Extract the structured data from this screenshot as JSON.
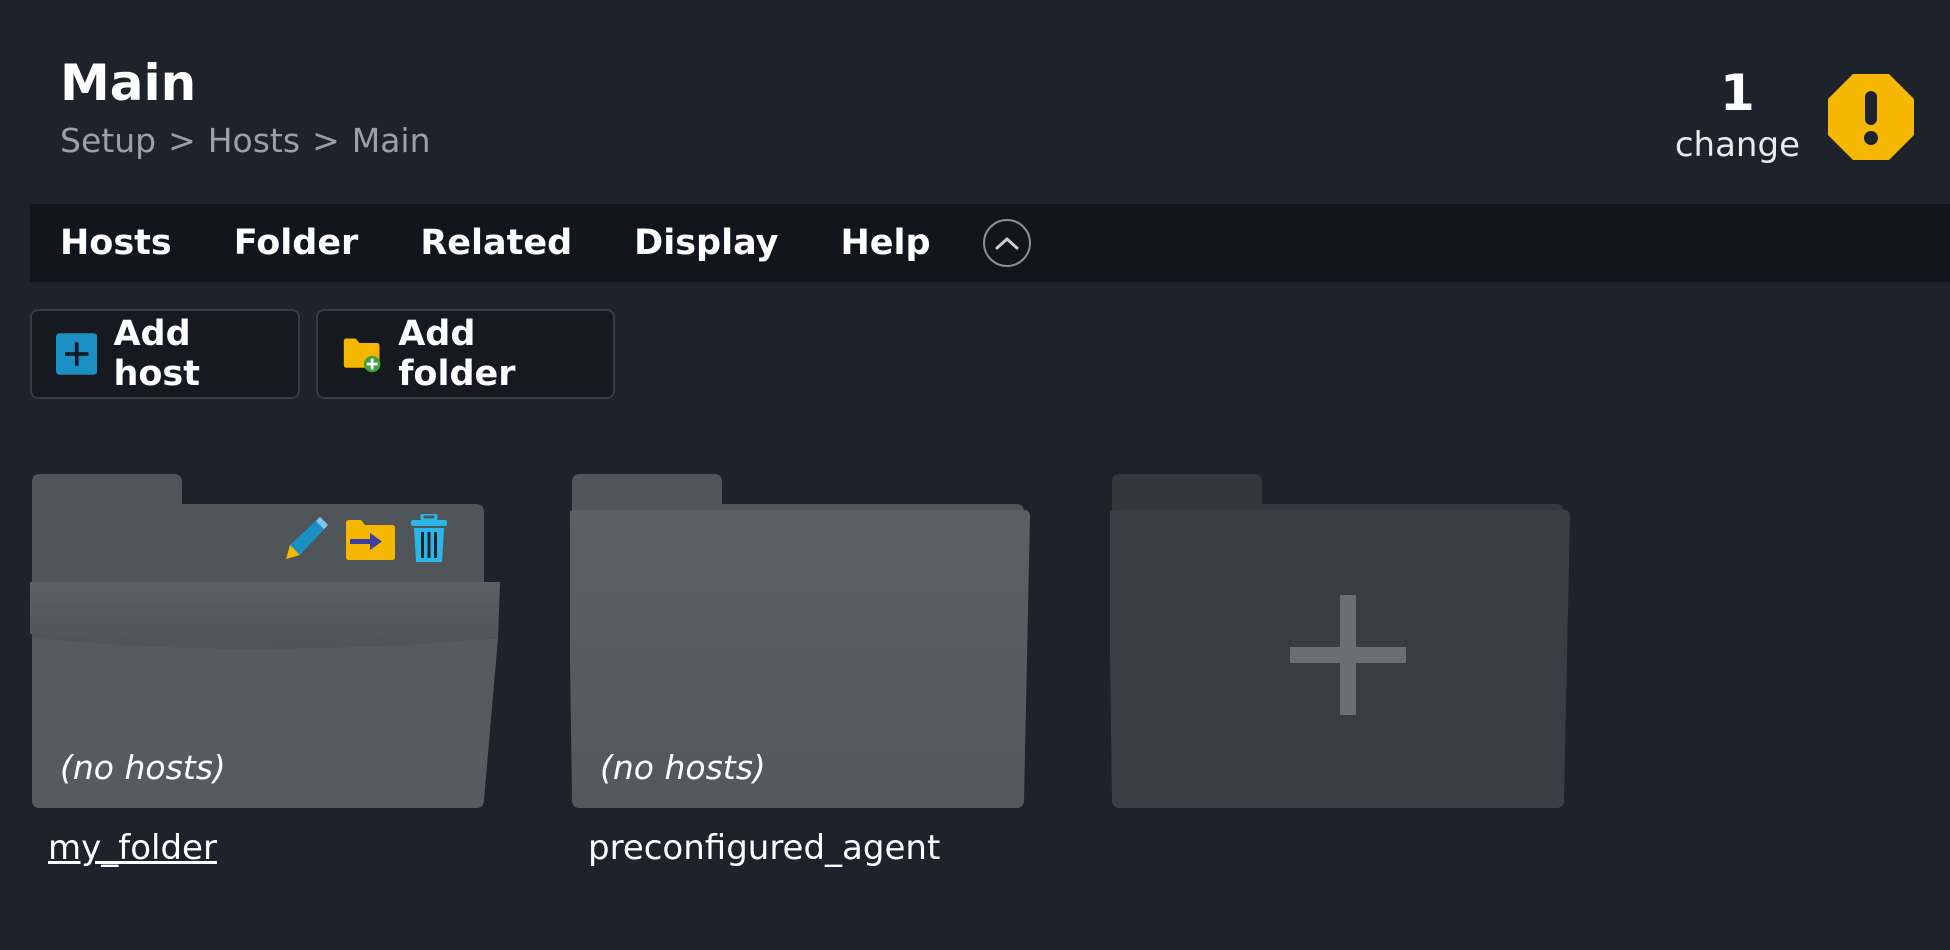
{
  "header": {
    "title": "Main",
    "breadcrumb": [
      "Setup",
      "Hosts",
      "Main"
    ],
    "breadcrumb_separator": ">"
  },
  "changes": {
    "count": "1",
    "label": "change",
    "badge_color": "#f5b700",
    "badge_icon": "exclamation-icon"
  },
  "menu": {
    "items": [
      "Hosts",
      "Folder",
      "Related",
      "Display",
      "Help"
    ],
    "collapse_icon": "chevron-up-icon"
  },
  "actions": {
    "add_host_label": "Add host",
    "add_host_icon": "plus-square-icon",
    "add_folder_label": "Add folder",
    "add_folder_icon": "folder-add-icon"
  },
  "folders": [
    {
      "name": "my_folder",
      "hosts_text": "(no hosts)",
      "tools": [
        "edit-icon",
        "move-icon",
        "delete-icon"
      ]
    },
    {
      "name": "preconfigured_agent",
      "hosts_text": "(no hosts)"
    },
    {
      "name": "",
      "type": "new-folder",
      "icon": "plus-icon"
    }
  ],
  "colors": {
    "background": "#1e222a",
    "menubar": "#11161c",
    "folder": "#555c5f",
    "accent_blue": "#1b8fc4",
    "accent_yellow": "#f5b700"
  }
}
